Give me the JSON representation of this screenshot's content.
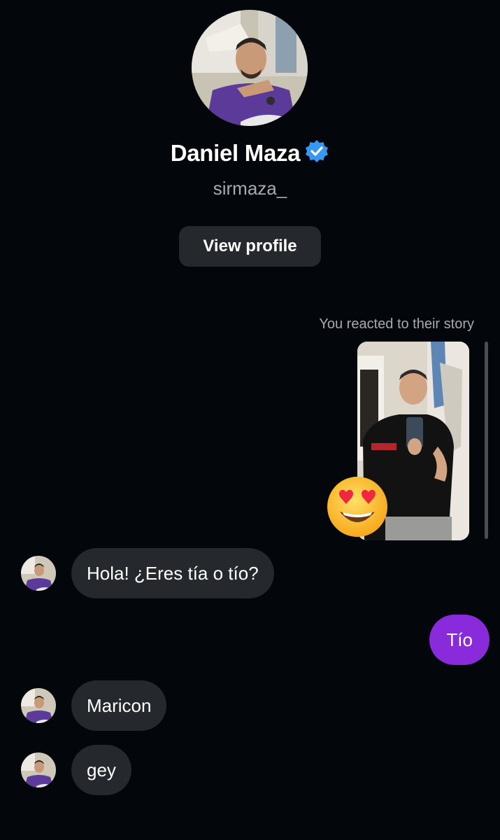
{
  "profile": {
    "display_name": "Daniel Maza",
    "verified_icon": "verified-badge-icon",
    "username": "sirmaza_",
    "view_profile_label": "View profile"
  },
  "story": {
    "label": "You reacted to their story",
    "reaction": "heart-eyes-emoji"
  },
  "messages": [
    {
      "side": "in",
      "text": "Hola! ¿Eres tía o tío?"
    },
    {
      "side": "out",
      "text": "Tío"
    },
    {
      "side": "in",
      "text": "Maricon"
    },
    {
      "side": "in",
      "text": "gey"
    }
  ],
  "colors": {
    "background": "#03060a",
    "incoming_bubble": "#25282d",
    "outgoing_bubble": "#8a2bdb",
    "verified_badge": "#3897f0",
    "secondary_text": "#a7aab0"
  }
}
